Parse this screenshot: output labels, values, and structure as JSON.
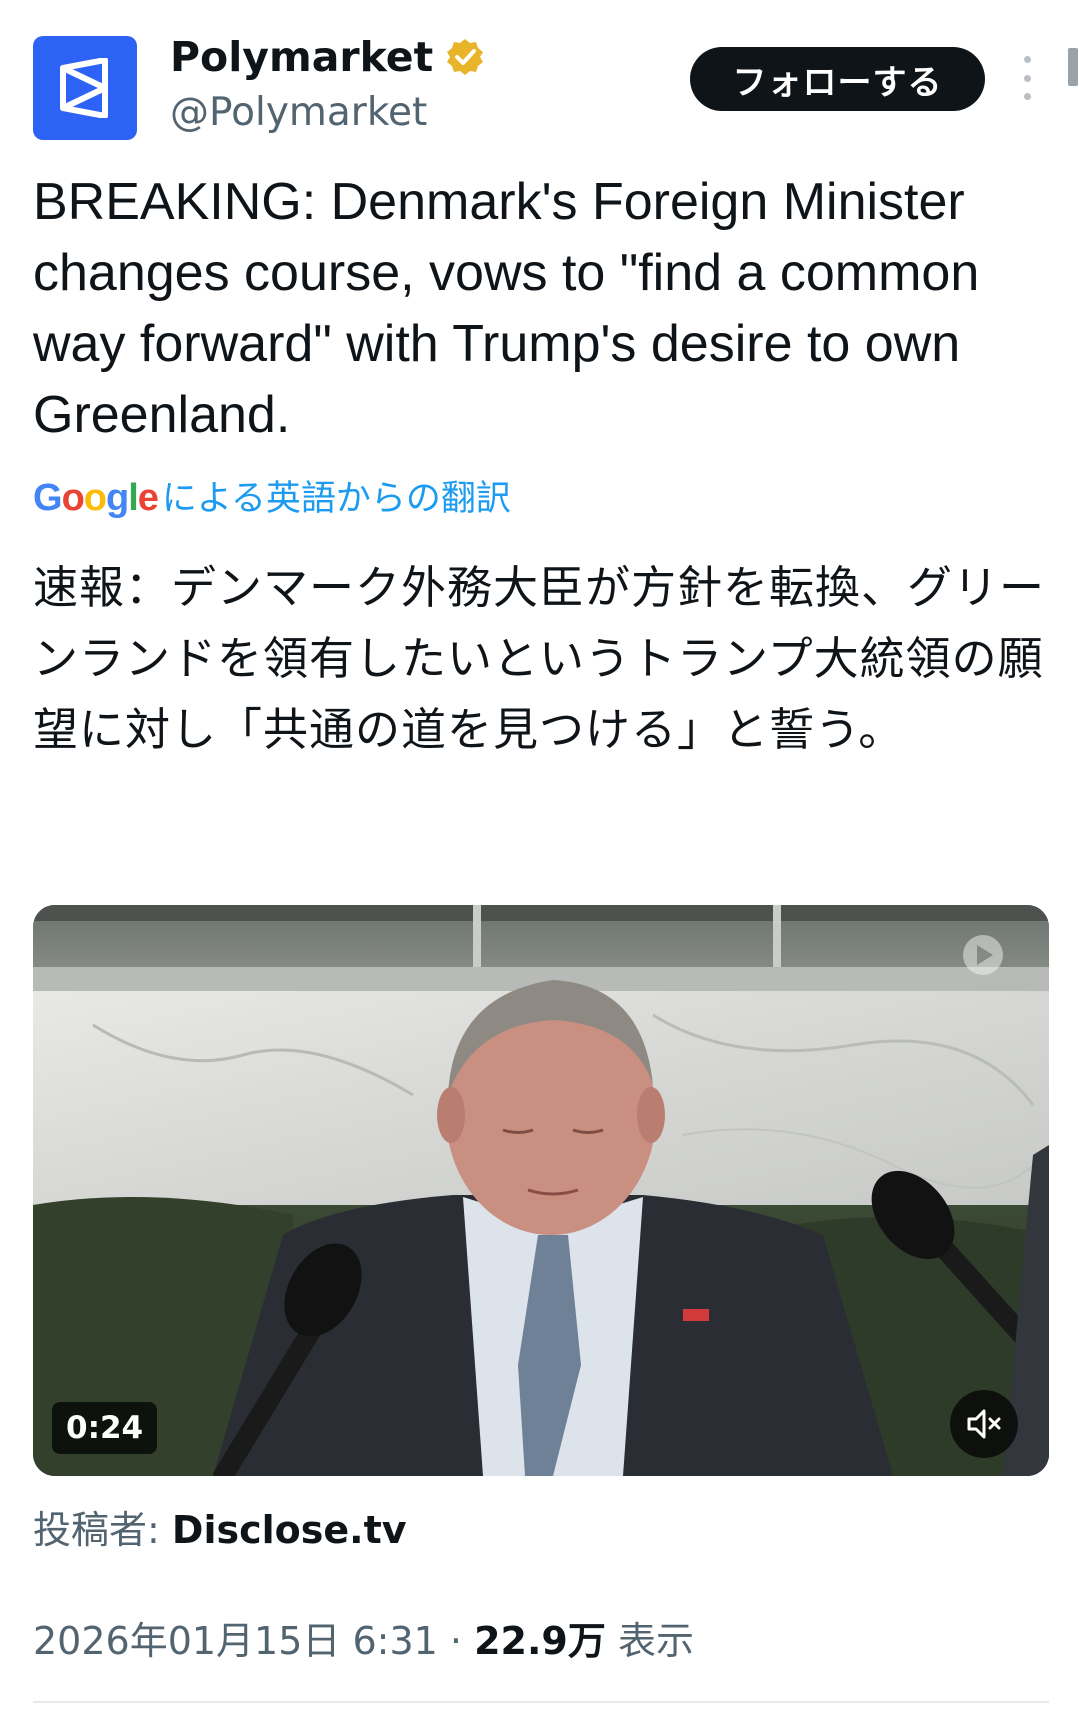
{
  "author": {
    "display_name": "Polymarket",
    "handle": "@Polymarket"
  },
  "follow_label": "フォローする",
  "tweet": {
    "text": "BREAKING: Denmark's Foreign Minister changes course, vows to \"find a common way forward\" with Trump's desire to own Greenland.",
    "translation_brand": "Google",
    "translation_label": "による英語からの翻訳",
    "translated_text": "速報：デンマーク外務大臣が方針を転換、グリーンランドを領有したいというトランプ大統領の願望に対し「共通の道を見つける」と誓う。"
  },
  "media": {
    "duration": "0:24"
  },
  "source": {
    "prefix": "投稿者:",
    "name": "Disclose.tv"
  },
  "meta": {
    "timestamp": "2026年01月15日 6:31",
    "separator": "·",
    "views": "22.9万",
    "views_label": "表示"
  },
  "colors": {
    "avatar": "#2d63f5",
    "verified": "#e8b42a",
    "link": "#1d9bf0",
    "muted_text": "#536471"
  },
  "icons": {
    "verified": "verified-badge-icon",
    "more": "more-options-icon",
    "mute": "volume-muted-icon",
    "watermark": "watermark-play-icon"
  }
}
